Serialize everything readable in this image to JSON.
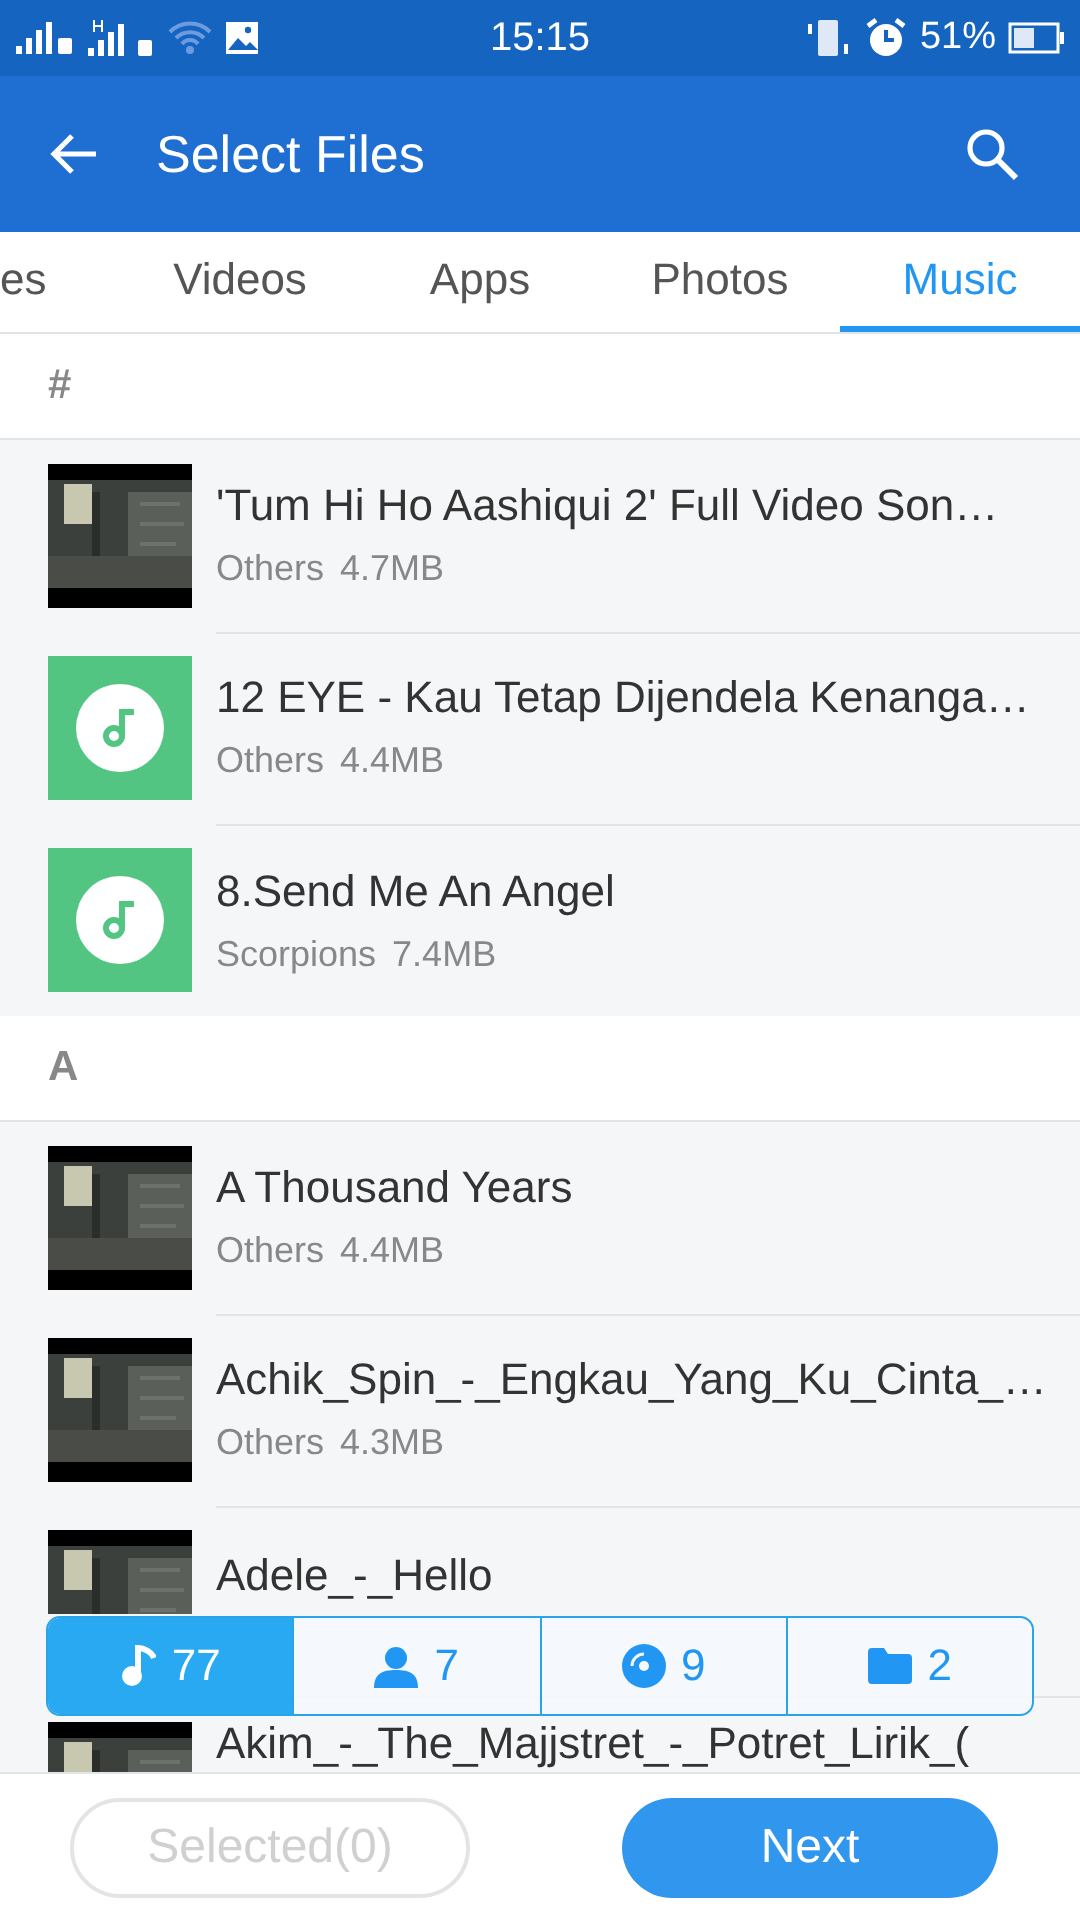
{
  "status_bar": {
    "time": "15:15",
    "battery": "51%"
  },
  "app_bar": {
    "title": "Select Files"
  },
  "tabs": [
    {
      "label": "es",
      "selected": false
    },
    {
      "label": "Videos",
      "selected": false
    },
    {
      "label": "Apps",
      "selected": false
    },
    {
      "label": "Photos",
      "selected": false
    },
    {
      "label": "Music",
      "selected": true
    }
  ],
  "sections": [
    {
      "header": "#",
      "items": [
        {
          "kind": "picture",
          "title": "'Tum Hi Ho Aashiqui 2' Full Video Son…",
          "artist": "Others",
          "size": "4.7MB"
        },
        {
          "kind": "music",
          "title": "12 EYE - Kau Tetap Dijendela Kenanga…",
          "artist": "Others",
          "size": "4.4MB"
        },
        {
          "kind": "music",
          "title": "8.Send Me An Angel",
          "artist": "Scorpions",
          "size": "7.4MB"
        }
      ]
    },
    {
      "header": "A",
      "items": [
        {
          "kind": "picture",
          "title": "A Thousand Years",
          "artist": "Others",
          "size": "4.4MB"
        },
        {
          "kind": "picture",
          "title": "Achik_Spin_-_Engkau_Yang_Ku_Cinta_…",
          "artist": "Others",
          "size": "4.3MB"
        },
        {
          "kind": "picture",
          "title": "Adele_-_Hello"
        },
        {
          "kind": "picture",
          "title": "Akim_-_The_Majjstret_-_Potret_Lirik_("
        }
      ]
    }
  ],
  "filters": [
    {
      "kind": "songs",
      "count": "77",
      "selected": true
    },
    {
      "kind": "artists",
      "count": "7",
      "selected": false
    },
    {
      "kind": "albums",
      "count": "9",
      "selected": false
    },
    {
      "kind": "folders",
      "count": "2",
      "selected": false
    }
  ],
  "footer": {
    "selected_button": "Selected(0)",
    "selected_disabled": true,
    "next_button": "Next"
  }
}
